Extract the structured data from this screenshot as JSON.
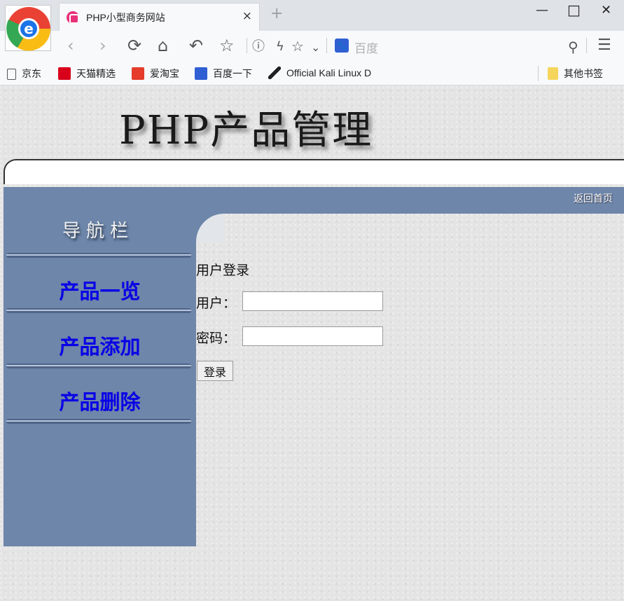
{
  "browser": {
    "tab_title": "PHP小型商务网站",
    "tab_close": "×",
    "new_tab": "+",
    "minimize": "—",
    "maximize": "□",
    "close": "✕",
    "address_placeholder": "百度"
  },
  "bookmarks": [
    {
      "label": "京东",
      "icon": "page-icon",
      "color": "#ffffff"
    },
    {
      "label": "天猫精选",
      "icon": "tmall-icon",
      "color": "#d9001b"
    },
    {
      "label": "爱淘宝",
      "icon": "taobao-icon",
      "color": "#e53c2b"
    },
    {
      "label": "百度一下",
      "icon": "baidu-icon",
      "color": "#2f5fd3"
    },
    {
      "label": "Official Kali Linux D",
      "icon": "kali-icon",
      "color": "#222222"
    },
    {
      "label": "其他书签",
      "icon": "folder-icon",
      "color": "#f6d55c"
    }
  ],
  "site": {
    "title": "PHP产品管理",
    "back_home": "返回首页",
    "sidebar_title": "导航栏",
    "nav": [
      {
        "label": "产品一览"
      },
      {
        "label": "产品添加"
      },
      {
        "label": "产品删除"
      }
    ]
  },
  "login": {
    "title": "用户登录",
    "user_label": "用户：",
    "user_value": "",
    "password_label": "密码：",
    "password_value": "",
    "submit_label": "登录"
  },
  "colors": {
    "sidebar": "#6d86aa",
    "nav_link": "#0a00e6"
  }
}
